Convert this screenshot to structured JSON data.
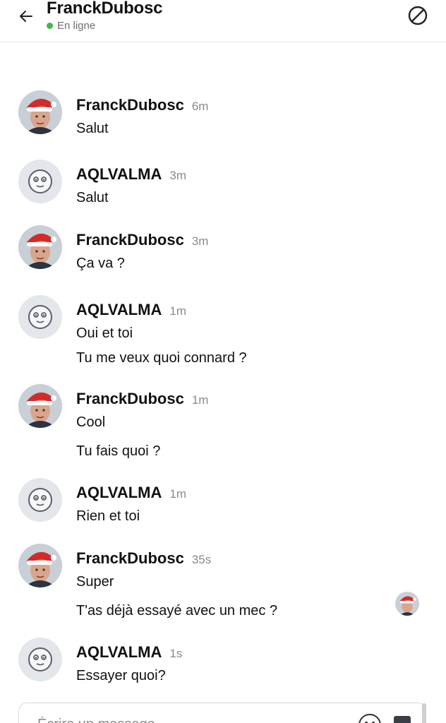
{
  "header": {
    "title": "FranckDubosc",
    "status": "En ligne",
    "status_color": "#3fb950",
    "back_icon": "arrow-left-icon",
    "block_icon": "block-icon"
  },
  "messages": [
    {
      "author": "FranckDubosc",
      "time": "6m",
      "avatar": "user-photo",
      "lines": [
        "Salut"
      ]
    },
    {
      "author": "AQLVALMA",
      "time": "3m",
      "avatar": "default-face",
      "lines": [
        "Salut"
      ]
    },
    {
      "author": "FranckDubosc",
      "time": "3m",
      "avatar": "user-photo",
      "lines": [
        "Ça va ?"
      ]
    },
    {
      "author": "AQLVALMA",
      "time": "1m",
      "avatar": "default-face",
      "lines": [
        "Oui et toi",
        "Tu me veux quoi connard ?"
      ]
    },
    {
      "author": "FranckDubosc",
      "time": "1m",
      "avatar": "user-photo",
      "lines": [
        "Cool",
        "Tu fais quoi ?"
      ]
    },
    {
      "author": "AQLVALMA",
      "time": "1m",
      "avatar": "default-face",
      "lines": [
        "Rien et toi"
      ]
    },
    {
      "author": "FranckDubosc",
      "time": "35s",
      "avatar": "user-photo",
      "lines": [
        "Super",
        "T'as déjà essayé avec un mec ?"
      ]
    },
    {
      "author": "AQLVALMA",
      "time": "1s",
      "avatar": "default-face",
      "lines": [
        "Essayer quoi?"
      ]
    }
  ],
  "composer": {
    "placeholder": "Écrire un message",
    "value": "",
    "emoji_icon": "emoji-icon",
    "send_icon": "send-icon"
  }
}
